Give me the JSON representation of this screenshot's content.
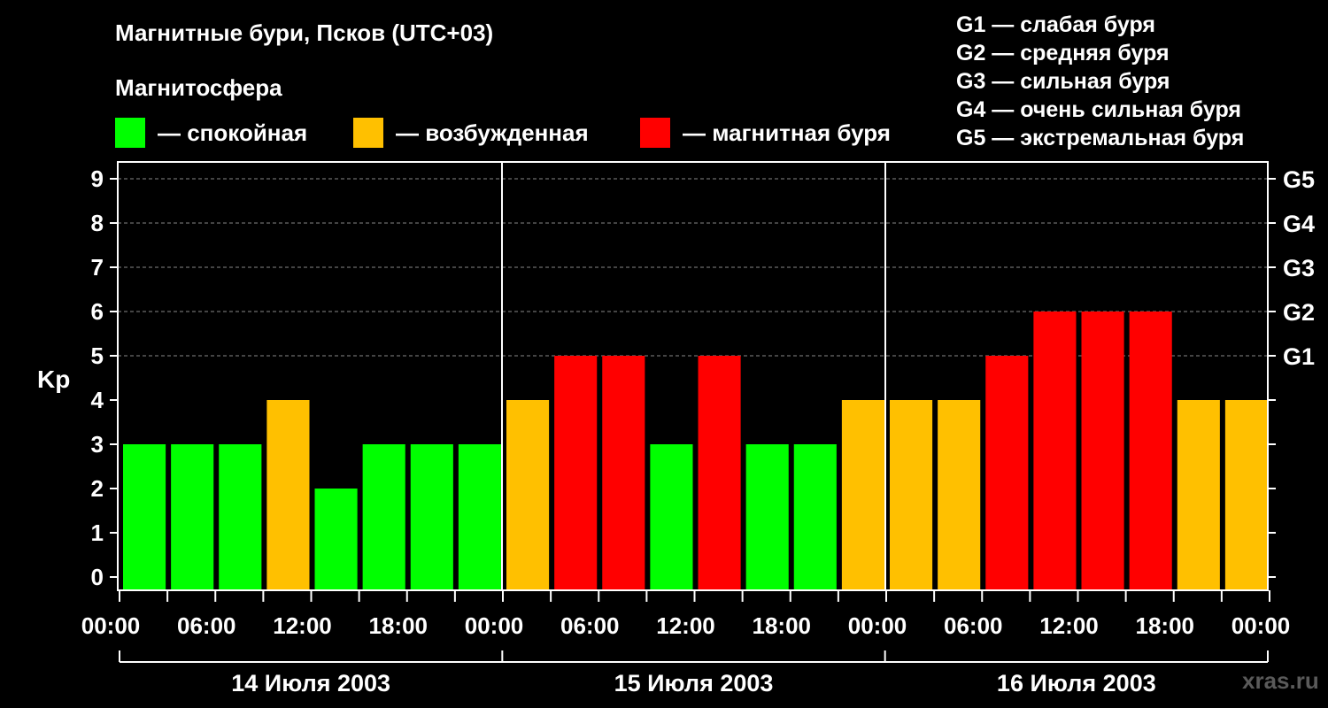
{
  "header": {
    "title": "Магнитные бури, Псков (UTC+03)",
    "subtitle": "Магнитосфера"
  },
  "legend": [
    {
      "label": "— спокойная",
      "color": "#00ff00"
    },
    {
      "label": "— возбужденная",
      "color": "#ffc000"
    },
    {
      "label": "— магнитная буря",
      "color": "#ff0000"
    }
  ],
  "g_scale": [
    "G1 — слабая буря",
    "G2 — средняя буря",
    "G3 — сильная буря",
    "G4 — очень сильная буря",
    "G5 — экстремальная буря"
  ],
  "watermark": "xras.ru",
  "chart_data": {
    "type": "bar",
    "title": "Магнитные бури, Псков (UTC+03)",
    "ylabel": "Kp",
    "ylim": [
      0,
      9
    ],
    "y_ticks": [
      "0",
      "1",
      "2",
      "3",
      "4",
      "5",
      "6",
      "7",
      "8",
      "9"
    ],
    "right_ticks": [
      {
        "value": 5,
        "label": "G1"
      },
      {
        "value": 6,
        "label": "G2"
      },
      {
        "value": 7,
        "label": "G3"
      },
      {
        "value": 8,
        "label": "G4"
      },
      {
        "value": 9,
        "label": "G5"
      }
    ],
    "grid": "horizontal dashed at 5–9",
    "x_tick_labels": [
      "00:00",
      "06:00",
      "12:00",
      "18:00",
      "00:00",
      "06:00",
      "12:00",
      "18:00",
      "00:00",
      "06:00",
      "12:00",
      "18:00",
      "00:00"
    ],
    "days": [
      "14 Июля 2003",
      "15 Июля 2003",
      "16 Июля 2003"
    ],
    "values": [
      3,
      3,
      3,
      4,
      2,
      3,
      3,
      3,
      4,
      5,
      5,
      3,
      5,
      3,
      3,
      4,
      4,
      4,
      5,
      6,
      6,
      6,
      4,
      4
    ],
    "colors": {
      "quiet": "#00ff00",
      "active": "#ffc000",
      "storm": "#ff0000"
    }
  }
}
